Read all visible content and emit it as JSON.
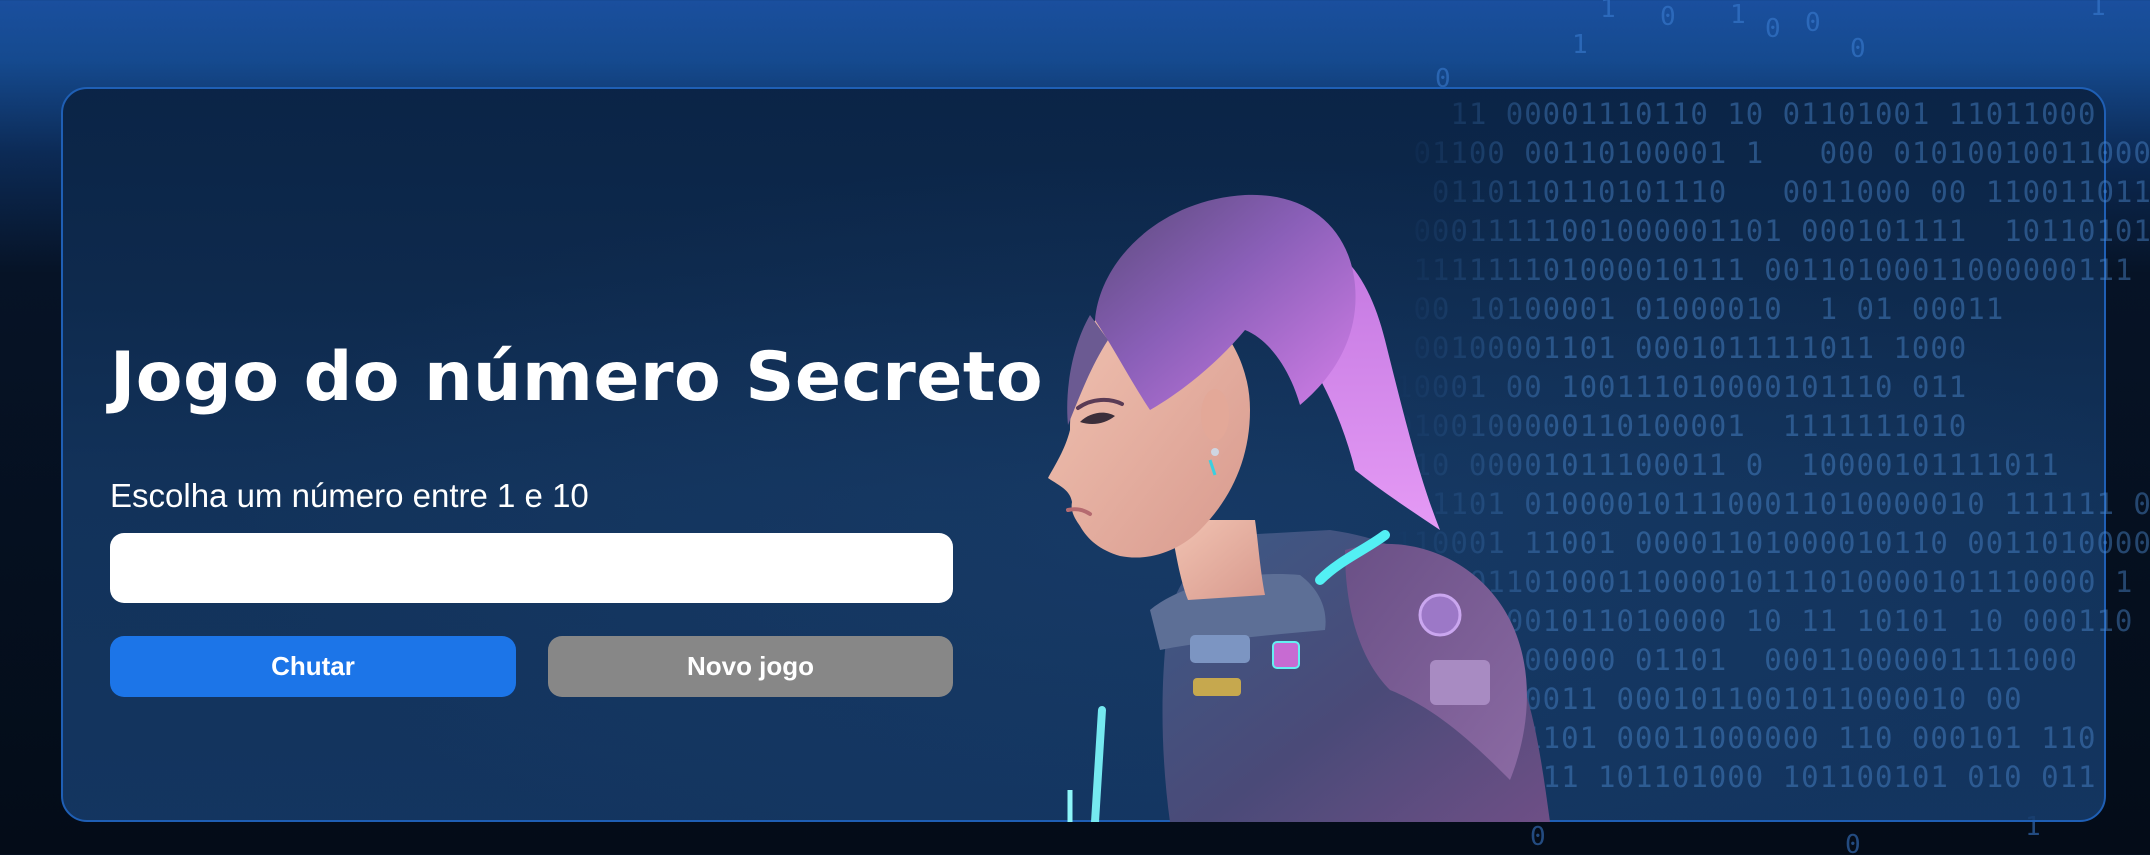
{
  "page": {
    "title": "Jogo do número Secreto",
    "instruction": "Escolha um número entre 1 e 10"
  },
  "input": {
    "value": "",
    "placeholder": ""
  },
  "buttons": {
    "guess_label": "Chutar",
    "new_game_label": "Novo jogo"
  },
  "colors": {
    "primary_button": "#1c75e8",
    "secondary_button": "#878787",
    "card_border": "#1f5fb5",
    "background_top": "#1a4f9e",
    "background_bottom": "#040c18"
  },
  "illustration": {
    "subject": "woman-in-sci-fi-armor-illustration"
  }
}
